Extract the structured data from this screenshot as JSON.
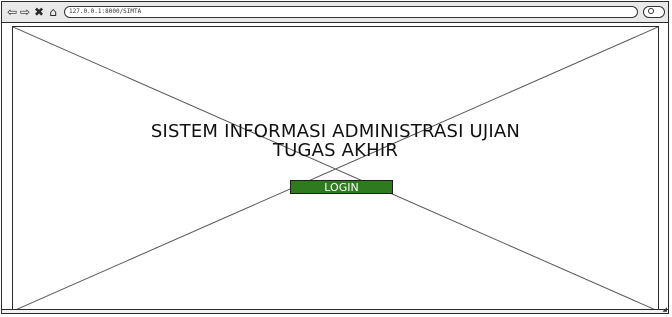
{
  "browser": {
    "back_icon": "back-arrow-icon",
    "forward_icon": "forward-arrow-icon",
    "stop_icon": "close-icon",
    "home_icon": "home-icon",
    "url": "127.0.0.1:8000/SIMTA",
    "search_icon": "search-icon"
  },
  "page": {
    "title_line1": "SISTEM INFORMASI ADMINISTRASI UJIAN",
    "title_line2": "TUGAS AKHIR",
    "login_label": "LOGIN",
    "login_color": "#2f7a1f",
    "placeholder_icon": "image-placeholder-icon"
  }
}
